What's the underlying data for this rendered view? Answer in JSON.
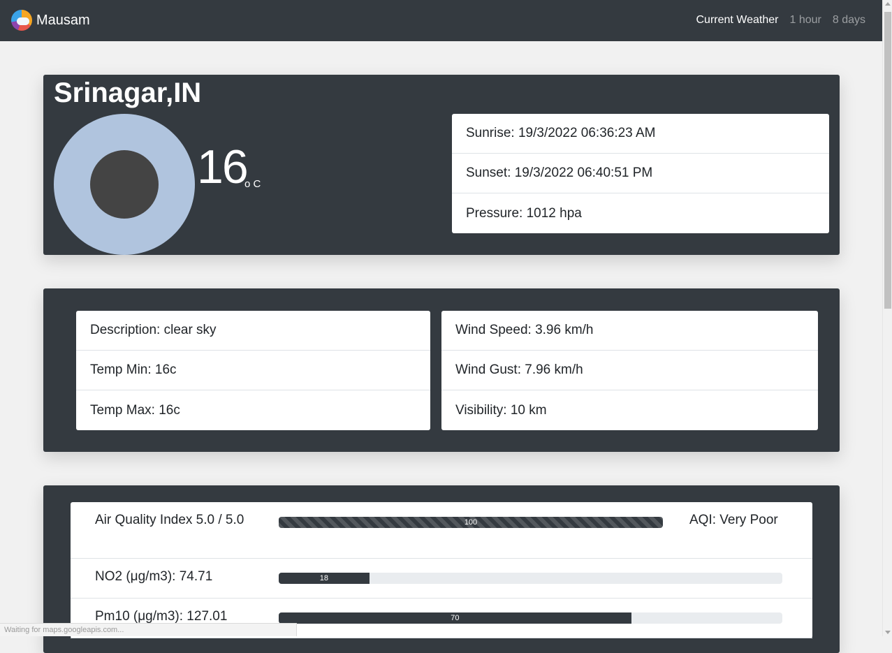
{
  "nav": {
    "brand": "Mausam",
    "links": [
      "Current Weather",
      "1 hour",
      "8 days"
    ]
  },
  "current": {
    "city": "Srinagar,IN",
    "temp": "16",
    "unit": "o C",
    "sun_list": [
      "Sunrise: 19/3/2022 06:36:23 AM",
      "Sunset: 19/3/2022 06:40:51 PM",
      "Pressure: 1012 hpa"
    ]
  },
  "details": {
    "left": [
      "Description: clear sky",
      "Temp Min: 16c",
      "Temp Max: 16c"
    ],
    "right": [
      "Wind Speed: 3.96 km/h",
      "Wind Gust: 7.96 km/h",
      "Visibility: 10 km"
    ]
  },
  "aqi": {
    "label": "Air Quality Index 5.0 / 5.0",
    "status": "AQI: Very Poor",
    "progress": 100,
    "progress_text": "100",
    "rows": [
      {
        "label": "NO2 (μg/m3): 74.71",
        "progress": 18,
        "progress_text": "18"
      },
      {
        "label": "Pm10 (μg/m3): 127.01",
        "progress": 70,
        "progress_text": "70"
      }
    ]
  },
  "status_bar": "Waiting for maps.googleapis.com..."
}
